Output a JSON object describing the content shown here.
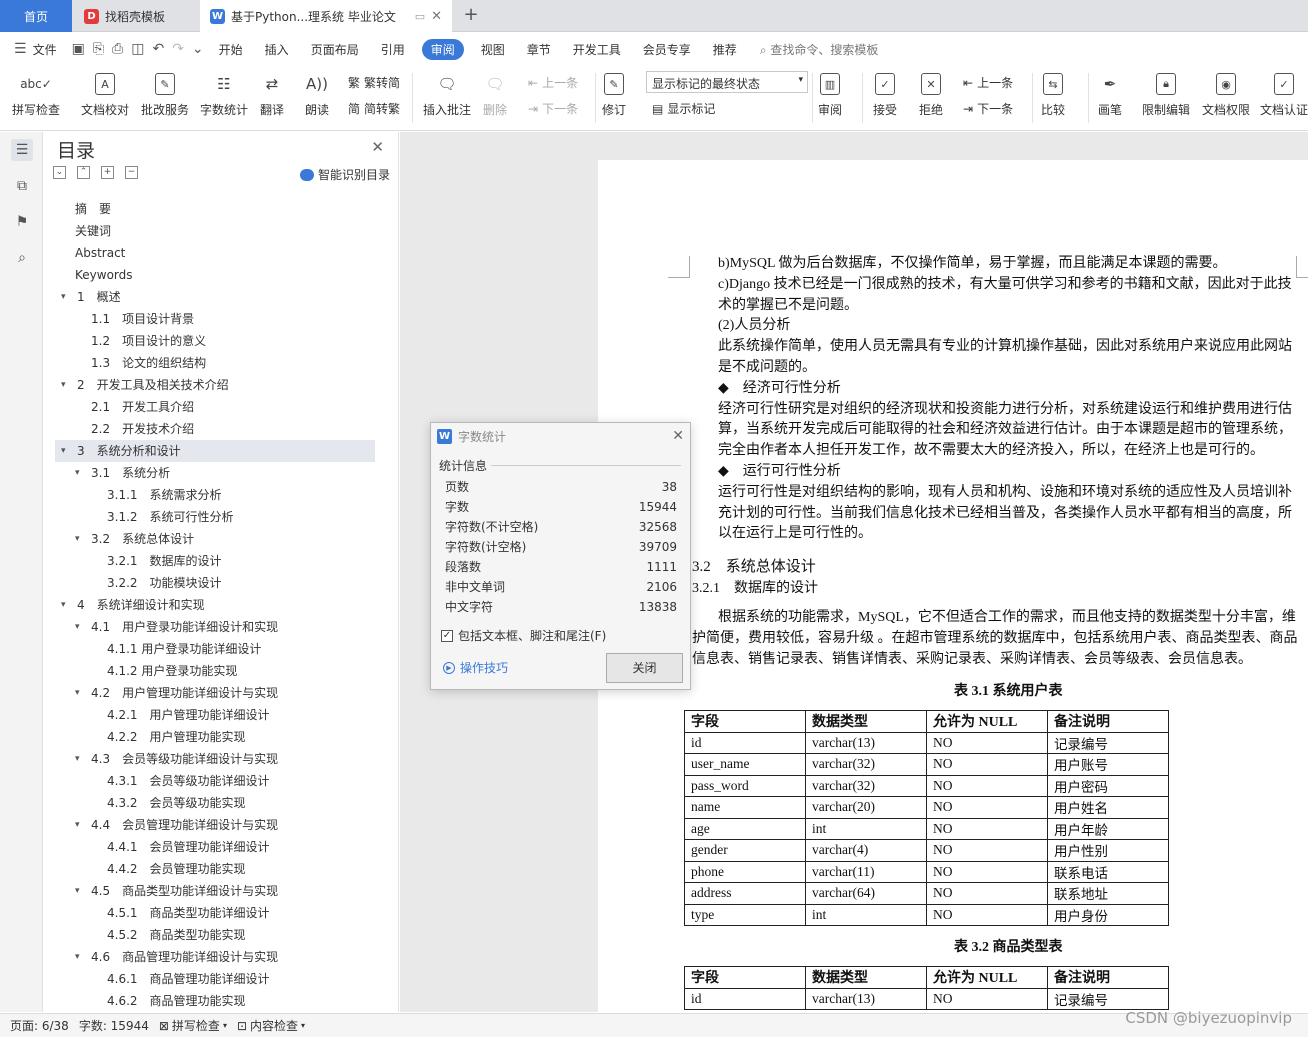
{
  "tabs": {
    "home": "首页",
    "t1": "找稻壳模板",
    "t2": "基于Python...理系统 毕业论文",
    "plus": "+"
  },
  "menubar": {
    "file": "文件",
    "items": [
      "开始",
      "插入",
      "页面布局",
      "引用",
      "审阅",
      "视图",
      "章节",
      "开发工具",
      "会员专享",
      "推荐"
    ],
    "active": "审阅",
    "search": "查找命令、搜索模板"
  },
  "ribbon": {
    "spell": "拼写检查",
    "proof": "文档校对",
    "batch": "批改服务",
    "wordcount": "字数统计",
    "translate": "翻译",
    "read": "朗读",
    "trad": "繁转简",
    "simp": "简转繁",
    "insert_comment": "插入批注",
    "delete": "删除",
    "prev": "上一条",
    "next": "下一条",
    "revise": "修订",
    "markup_dropdown": "显示标记的最终状态",
    "show_markup": "显示标记",
    "review": "审阅",
    "accept": "接受",
    "reject": "拒绝",
    "prev2": "上一条",
    "next2": "下一条",
    "compare": "比较",
    "pen": "画笔",
    "restrict": "限制编辑",
    "permission": "文档权限",
    "certify": "文档认证"
  },
  "toc": {
    "title": "目录",
    "smart": "智能识别目录",
    "entries": [
      {
        "t": "摘　要",
        "lv": 0
      },
      {
        "t": "关键词",
        "lv": 0
      },
      {
        "t": "Abstract",
        "lv": 0
      },
      {
        "t": "Keywords",
        "lv": 0
      },
      {
        "t": "1　概述",
        "lv": 1,
        "ar": "v"
      },
      {
        "t": "1.1　项目设计背景",
        "lv": 2
      },
      {
        "t": "1.2　项目设计的意义",
        "lv": 2
      },
      {
        "t": "1.3　论文的组织结构",
        "lv": 2
      },
      {
        "t": "2　开发工具及相关技术介绍",
        "lv": 1,
        "ar": "v"
      },
      {
        "t": "2.1　开发工具介绍",
        "lv": 2
      },
      {
        "t": "2.2　开发技术介绍",
        "lv": 2
      },
      {
        "t": "3　系统分析和设计",
        "lv": 1,
        "ar": "v",
        "sel": true
      },
      {
        "t": "3.1　系统分析",
        "lv": 2,
        "ar": "v"
      },
      {
        "t": "3.1.1　系统需求分析",
        "lv": 3
      },
      {
        "t": "3.1.2　系统可行性分析",
        "lv": 3
      },
      {
        "t": "3.2　系统总体设计",
        "lv": 2,
        "ar": "v"
      },
      {
        "t": "3.2.1　数据库的设计",
        "lv": 3
      },
      {
        "t": "3.2.2　功能模块设计",
        "lv": 3
      },
      {
        "t": "4　系统详细设计和实现",
        "lv": 1,
        "ar": "v"
      },
      {
        "t": "4.1　用户登录功能详细设计和实现",
        "lv": 2,
        "ar": "v"
      },
      {
        "t": "4.1.1 用户登录功能详细设计",
        "lv": 3
      },
      {
        "t": "4.1.2 用户登录功能实现",
        "lv": 3
      },
      {
        "t": "4.2　用户管理功能详细设计与实现",
        "lv": 2,
        "ar": "v"
      },
      {
        "t": "4.2.1　用户管理功能详细设计",
        "lv": 3
      },
      {
        "t": "4.2.2　用户管理功能实现",
        "lv": 3
      },
      {
        "t": "4.3　会员等级功能详细设计与实现",
        "lv": 2,
        "ar": "v"
      },
      {
        "t": "4.3.1　会员等级功能详细设计",
        "lv": 3
      },
      {
        "t": "4.3.2　会员等级功能实现",
        "lv": 3
      },
      {
        "t": "4.4　会员管理功能详细设计与实现",
        "lv": 2,
        "ar": "v"
      },
      {
        "t": "4.4.1　会员管理功能详细设计",
        "lv": 3
      },
      {
        "t": "4.4.2　会员管理功能实现",
        "lv": 3
      },
      {
        "t": "4.5　商品类型功能详细设计与实现",
        "lv": 2,
        "ar": "v"
      },
      {
        "t": "4.5.1　商品类型功能详细设计",
        "lv": 3
      },
      {
        "t": "4.5.2　商品类型功能实现",
        "lv": 3
      },
      {
        "t": "4.6　商品管理功能详细设计与实现",
        "lv": 2,
        "ar": "v"
      },
      {
        "t": "4.6.1　商品管理功能详细设计",
        "lv": 3
      },
      {
        "t": "4.6.2　商品管理功能实现",
        "lv": 3
      }
    ]
  },
  "doc": {
    "paras": [
      "b)MySQL 做为后台数据库，不仅操作简单，易于掌握，而且能满足本课题的需要。",
      "c)Django 技术已经是一门很成熟的技术，有大量可供学习和参考的书籍和文献，因此对于此技术的掌握已不是问题。",
      "(2)人员分析",
      "此系统操作简单，使用人员无需具有专业的计算机操作基础，因此对系统用户来说应用此网站是不成问题的。",
      "◆　经济可行性分析",
      "经济可行性研究是对组织的经济现状和投资能力进行分析，对系统建设运行和维护费用进行估算，当系统开发完成后可能取得的社会和经济效益进行估计。由于本课题是超市的管理系统，完全由作者本人担任开发工作，故不需要太大的经济投入，所以，在经济上也是可行的。",
      "◆　运行可行性分析",
      "运行可行性是对组织结构的影响，现有人员和机构、设施和环境对系统的适应性及人员培训补充计划的可行性。当前我们信息化技术已经相当普及，各类操作人员水平都有相当的高度，所以在运行上是可行性的。"
    ],
    "h_32": "3.2　系统总体设计",
    "h_321": "3.2.1　数据库的设计",
    "para_db": "根据系统的功能需求，MySQL，它不但适合工作的需求，而且他支持的数据类型十分丰富，维护简便，费用较低，容易升级 。在超市管理系统的数据库中，包括系统用户表、商品类型表、商品信息表、销售记录表、销售详情表、采购记录表、采购详情表、会员等级表、会员信息表。",
    "cap1": "表 3.1 系统用户表",
    "cap2": "表 3.2 商品类型表",
    "headers": [
      "字段",
      "数据类型",
      "允许为 NULL",
      "备注说明"
    ],
    "table1": [
      [
        "id",
        "varchar(13)",
        "NO",
        "记录编号"
      ],
      [
        "user_name",
        "varchar(32)",
        "NO",
        "用户账号"
      ],
      [
        "pass_word",
        "varchar(32)",
        "NO",
        "用户密码"
      ],
      [
        "name",
        "varchar(20)",
        "NO",
        "用户姓名"
      ],
      [
        "age",
        "int",
        "NO",
        "用户年龄"
      ],
      [
        "gender",
        "varchar(4)",
        "NO",
        "用户性别"
      ],
      [
        "phone",
        "varchar(11)",
        "NO",
        "联系电话"
      ],
      [
        "address",
        "varchar(64)",
        "NO",
        "联系地址"
      ],
      [
        "type",
        "int",
        "NO",
        "用户身份"
      ]
    ],
    "table2": [
      [
        "id",
        "varchar(13)",
        "NO",
        "记录编号"
      ]
    ]
  },
  "dialog": {
    "title": "字数统计",
    "section": "统计信息",
    "rows": [
      [
        "页数",
        "38"
      ],
      [
        "字数",
        "15944"
      ],
      [
        "字符数(不计空格)",
        "32568"
      ],
      [
        "字符数(计空格)",
        "39709"
      ],
      [
        "段落数",
        "1111"
      ],
      [
        "非中文单词",
        "2106"
      ],
      [
        "中文字符",
        "13838"
      ]
    ],
    "checkbox": "包括文本框、脚注和尾注(F)",
    "tips": "操作技巧",
    "close": "关闭"
  },
  "status": {
    "page": "页面: 6/38",
    "words": "字数: 15944",
    "spell": "拼写检查",
    "content": "内容检查"
  },
  "watermark": "CSDN @biyezuopinvip"
}
